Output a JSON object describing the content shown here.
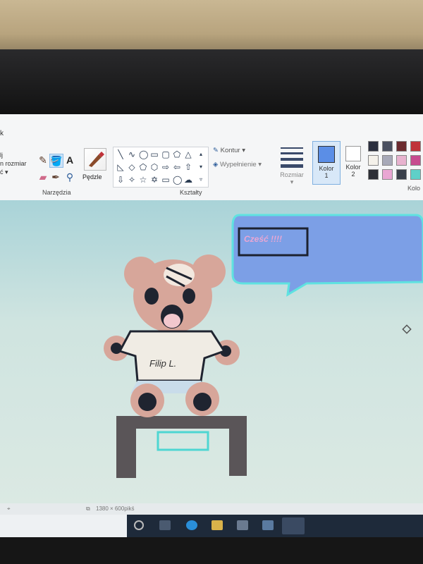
{
  "ribbon": {
    "tab_fragment": "k",
    "left_items": [
      "lj",
      "n rozmiar",
      "ć ▾"
    ],
    "tools_group_label": "Narzędzia",
    "brushes_label": "Pędzle",
    "shapes_group_label": "Kształty",
    "outline_label": "Kontur ▾",
    "fill_label": "Wypełnienie ▾",
    "size_label": "Rozmiar",
    "color1_label": "Kolor\n1",
    "color2_label": "Kolor\n2",
    "colors_group_fragment": "Kolo"
  },
  "colors": {
    "color1": "#5b8ee6",
    "color2": "#ffffff",
    "palette": [
      "#2b2f3e",
      "#4a5060",
      "#6b2a2e",
      "#c0333a",
      "#f4f1ea",
      "#a7a9b8",
      "#e8b3cf",
      "#c74b8f",
      "#2d2f36",
      "#e9a6d3",
      "#3a3f4a",
      "#5fd0c8"
    ]
  },
  "canvas": {
    "bubble_text": "Cześć !!!!",
    "shirt_text": "Filip L.",
    "icons": [
      "pencil-icon",
      "fill-icon",
      "text-icon",
      "eraser-icon",
      "color-picker-icon",
      "magnifier-icon"
    ]
  },
  "status": {
    "dimensions": "1380 × 600pikś"
  }
}
